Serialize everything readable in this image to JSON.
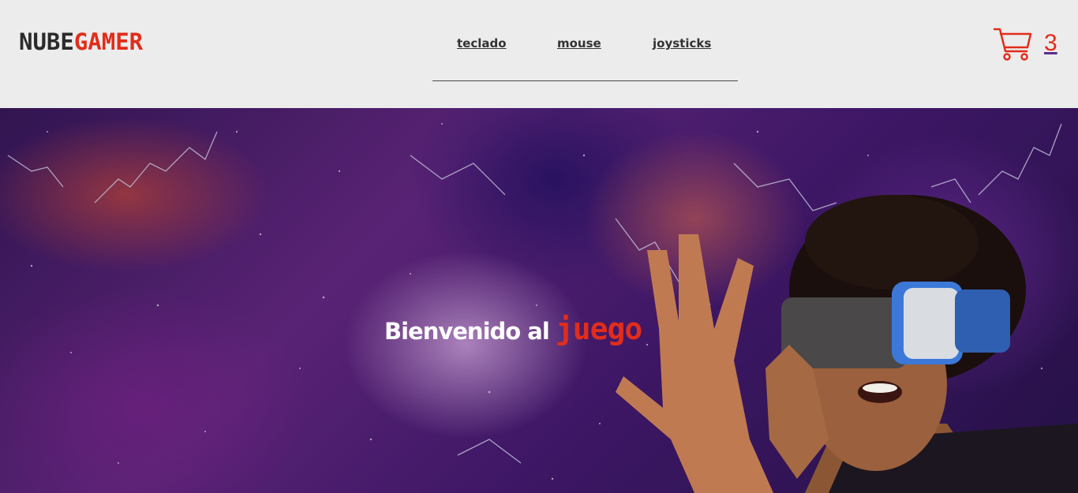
{
  "header": {
    "logo": {
      "part1": "NUBE",
      "part2": "GAMER"
    },
    "nav": [
      {
        "label": "teclado"
      },
      {
        "label": "mouse"
      },
      {
        "label": "joysticks"
      }
    ],
    "cart": {
      "icon": "cart-icon",
      "count": "3"
    }
  },
  "hero": {
    "welcome_text": "Bienvenido al",
    "highlight_text": "juego",
    "image": "vr-headset-person-galaxy-background"
  },
  "colors": {
    "accent": "#e12d1b",
    "header_bg": "#ececec",
    "text_dark": "#2b2b2b"
  }
}
